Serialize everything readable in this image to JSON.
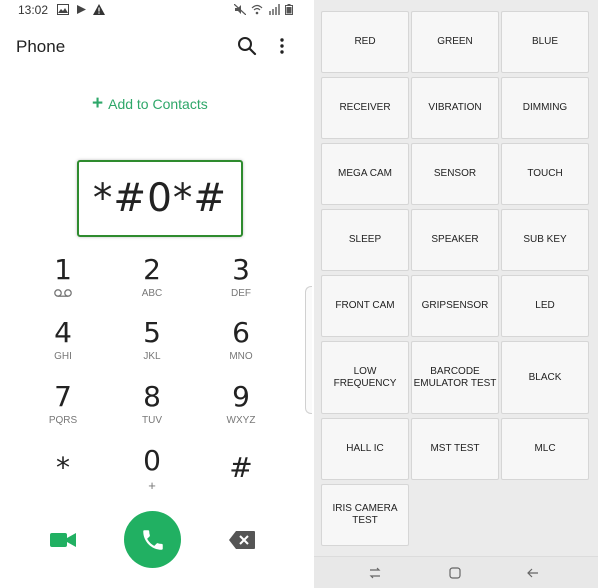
{
  "status_bar": {
    "time": "13:02"
  },
  "header": {
    "title": "Phone"
  },
  "add_contacts": {
    "label": "Add to Contacts"
  },
  "dialed": {
    "value": "*#0*#"
  },
  "keypad": [
    {
      "num": "1",
      "sub": ""
    },
    {
      "num": "2",
      "sub": "ABC"
    },
    {
      "num": "3",
      "sub": "DEF"
    },
    {
      "num": "4",
      "sub": "GHI"
    },
    {
      "num": "5",
      "sub": "JKL"
    },
    {
      "num": "6",
      "sub": "MNO"
    },
    {
      "num": "7",
      "sub": "PQRS"
    },
    {
      "num": "8",
      "sub": "TUV"
    },
    {
      "num": "9",
      "sub": "WXYZ"
    },
    {
      "num": "*",
      "sub": ""
    },
    {
      "num": "0",
      "sub": "+"
    },
    {
      "num": "#",
      "sub": ""
    }
  ],
  "colors": {
    "accent": "#21b062",
    "highlight_border": "#2e8b2e"
  },
  "test_menu": {
    "buttons": [
      "RED",
      "GREEN",
      "BLUE",
      "RECEIVER",
      "VIBRATION",
      "DIMMING",
      "MEGA CAM",
      "SENSOR",
      "TOUCH",
      "SLEEP",
      "SPEAKER",
      "SUB KEY",
      "FRONT CAM",
      "GRIPSENSOR",
      "LED",
      "LOW FREQUENCY",
      "BARCODE\nEMULATOR TEST",
      "BLACK",
      "HALL IC",
      "MST TEST",
      "MLC",
      "IRIS CAMERA TEST"
    ]
  },
  "icons": {
    "status_left": [
      "image-icon",
      "play-store-icon",
      "warning-icon"
    ],
    "status_right": [
      "mute-icon",
      "wifi-icon",
      "signal-icon",
      "battery-icon"
    ],
    "nav": [
      "recent-apps-icon",
      "home-icon",
      "back-icon"
    ]
  }
}
